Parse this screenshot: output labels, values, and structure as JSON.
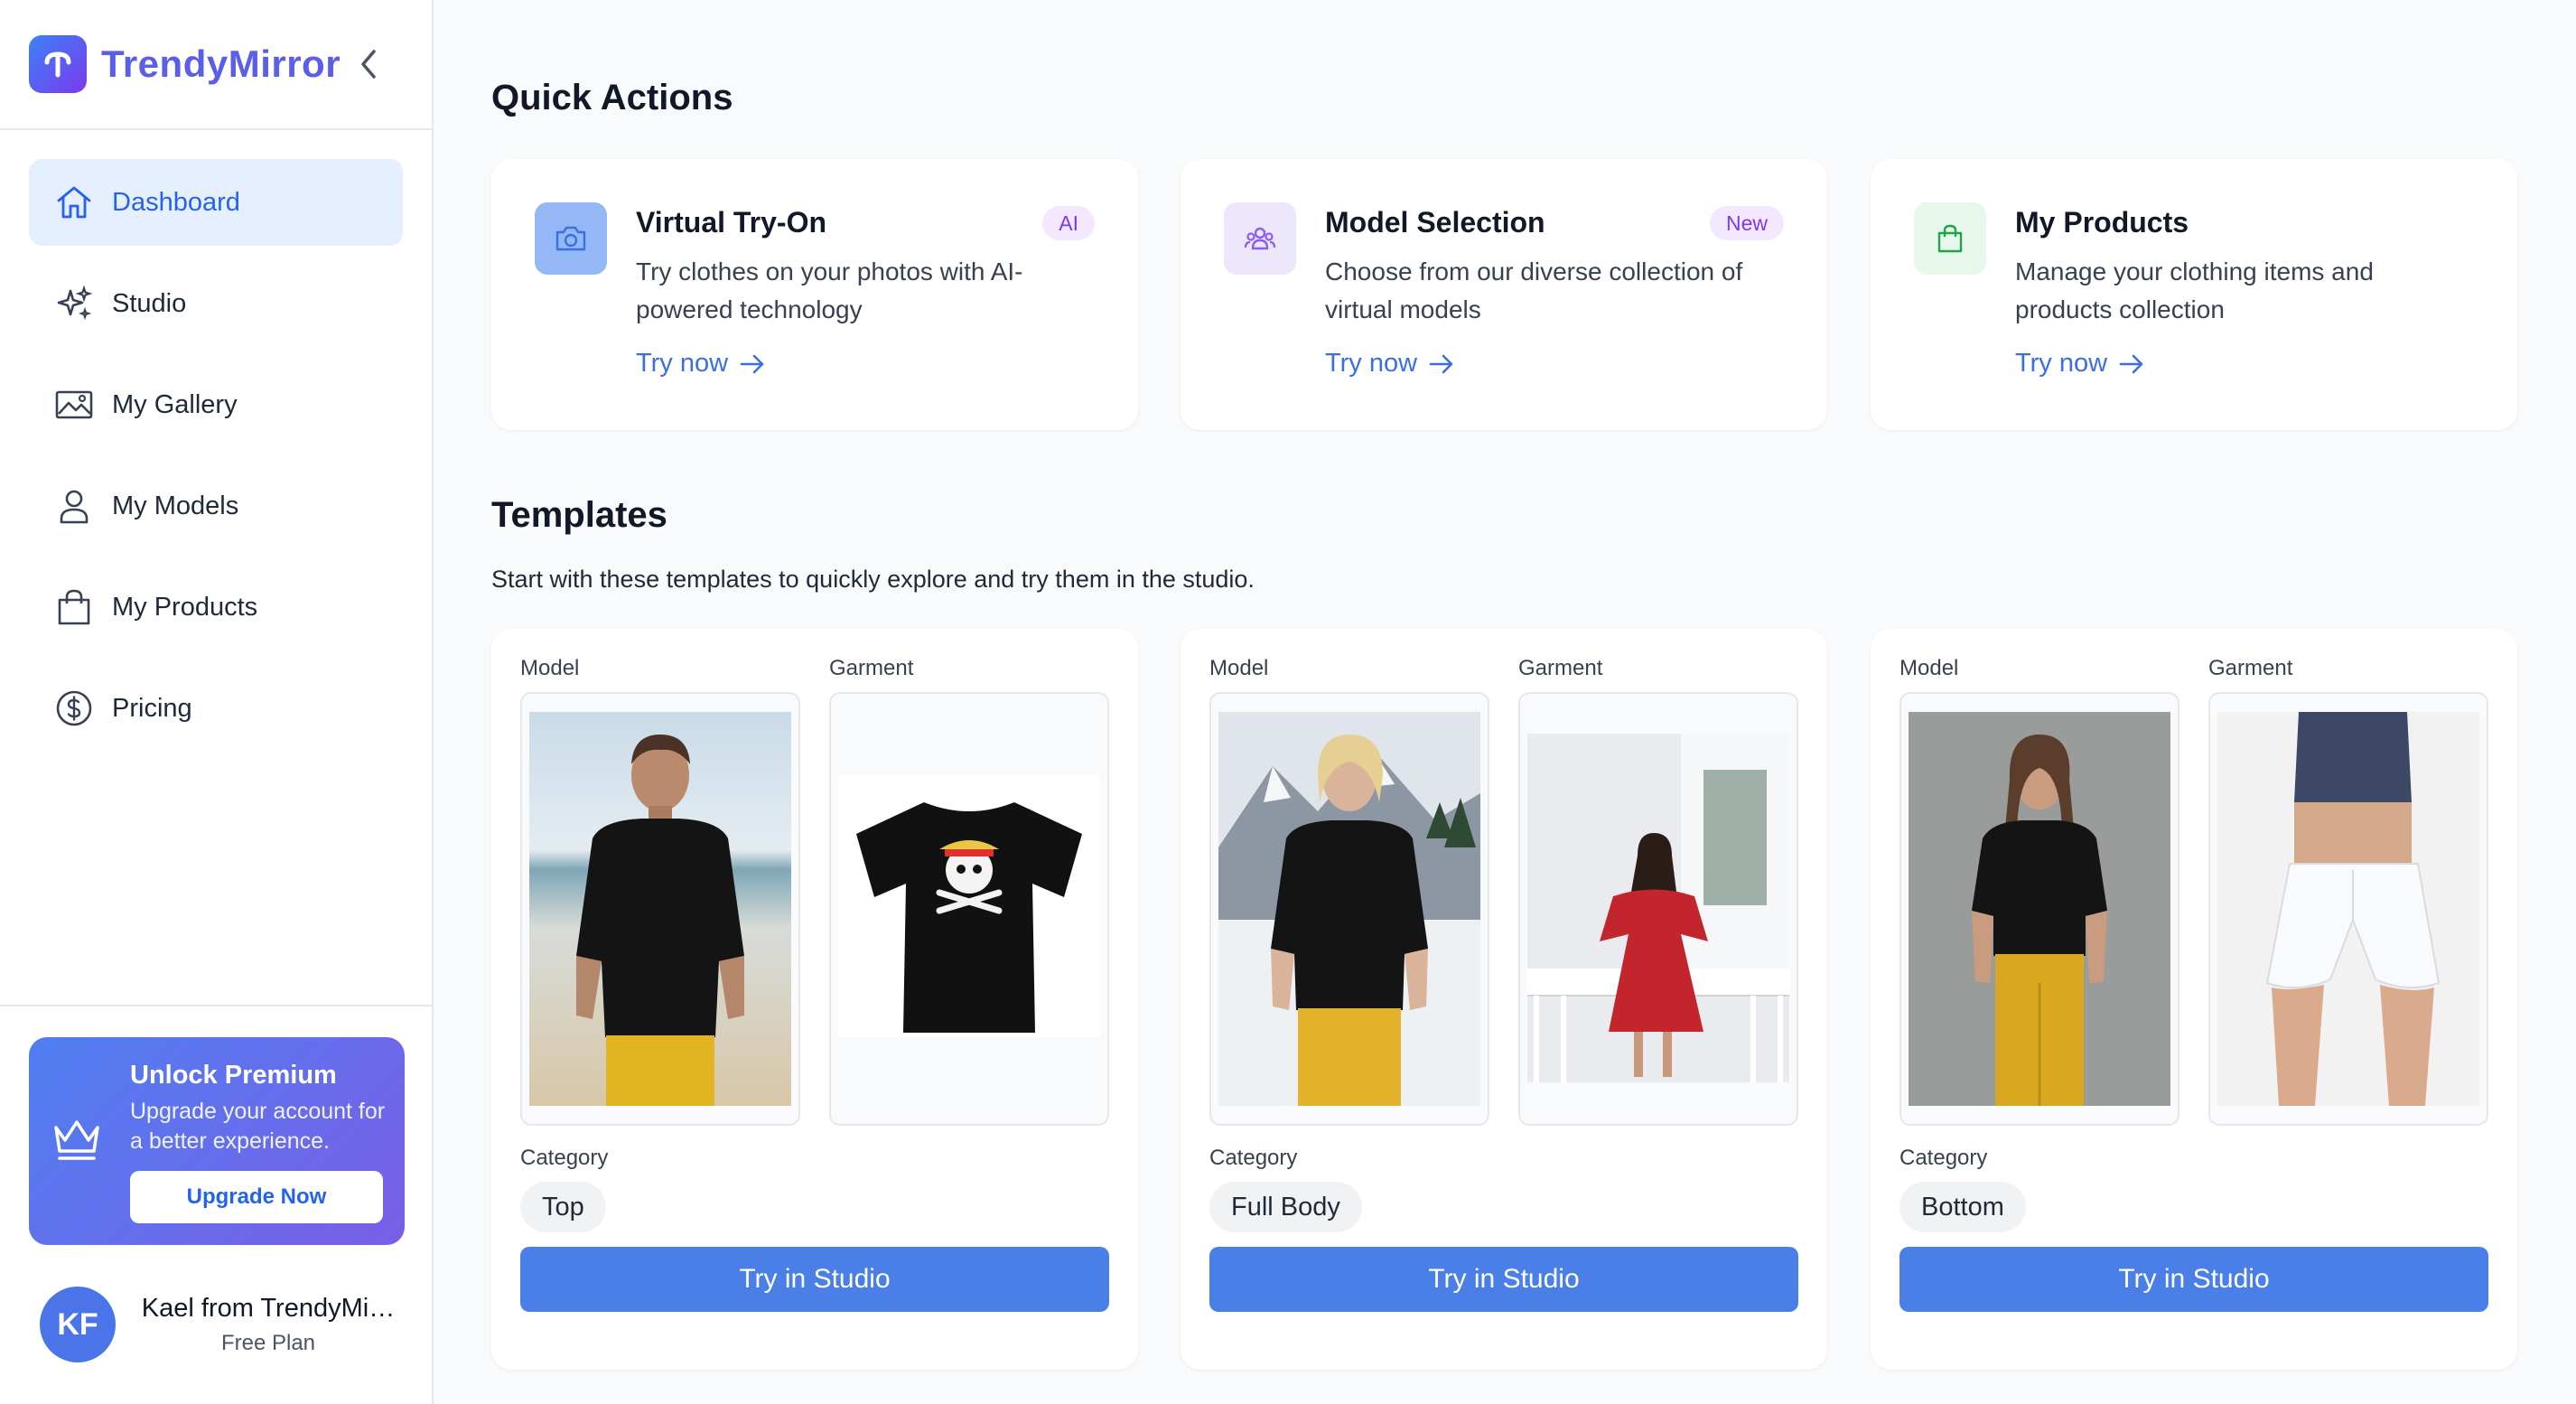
{
  "brand": {
    "name": "TrendyMirror"
  },
  "colors": {
    "accent": "#4a7fe8",
    "brand_text": "#5b5fe8",
    "active_nav_bg": "#e6efff"
  },
  "sidebar": {
    "items": [
      {
        "label": "Dashboard",
        "icon": "home-icon",
        "active": true
      },
      {
        "label": "Studio",
        "icon": "sparkles-icon",
        "active": false
      },
      {
        "label": "My Gallery",
        "icon": "image-icon",
        "active": false
      },
      {
        "label": "My Models",
        "icon": "user-icon",
        "active": false
      },
      {
        "label": "My Products",
        "icon": "shopping-bag-icon",
        "active": false
      },
      {
        "label": "Pricing",
        "icon": "dollar-circle-icon",
        "active": false
      }
    ]
  },
  "premium": {
    "title": "Unlock Premium",
    "description": "Upgrade your account for a better experience.",
    "button": "Upgrade Now"
  },
  "user": {
    "initials": "KF",
    "name": "Kael from TrendyMi…",
    "plan": "Free Plan"
  },
  "quick_actions": {
    "title": "Quick Actions",
    "cards": [
      {
        "title": "Virtual Try-On",
        "badge": "AI",
        "description": "Try clothes on your photos with AI-powered technology",
        "link": "Try now",
        "icon": "camera-icon"
      },
      {
        "title": "Model Selection",
        "badge": "New",
        "description": "Choose from our diverse collection of virtual models",
        "link": "Try now",
        "icon": "users-icon"
      },
      {
        "title": "My Products",
        "badge": "",
        "description": "Manage your clothing items and products collection",
        "link": "Try now",
        "icon": "shopping-bag-icon"
      }
    ]
  },
  "templates": {
    "title": "Templates",
    "subtitle": "Start with these templates to quickly explore and try them in the studio.",
    "model_label": "Model",
    "garment_label": "Garment",
    "category_label": "Category",
    "button": "Try in Studio",
    "cards": [
      {
        "category": "Top"
      },
      {
        "category": "Full Body"
      },
      {
        "category": "Bottom"
      }
    ]
  }
}
